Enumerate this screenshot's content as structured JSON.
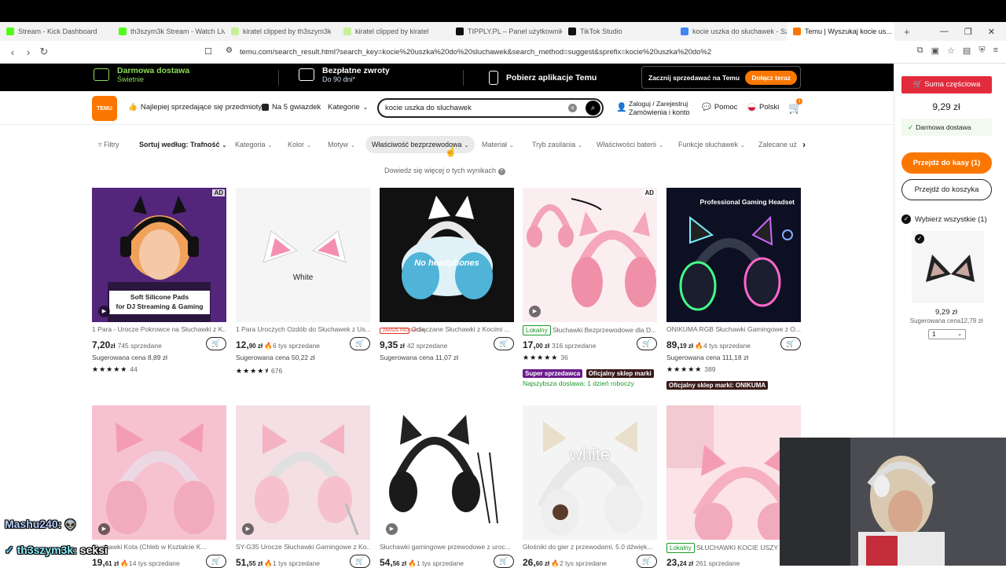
{
  "browser": {
    "tabs": [
      {
        "label": "Stream - Kick Dashboard",
        "color": "#53fc18"
      },
      {
        "label": "th3szym3k Stream - Watch Live",
        "color": "#53fc18"
      },
      {
        "label": "kiratel clipped by th3szym3k",
        "color": "#c8f09a"
      },
      {
        "label": "kiratel clipped by kiratel",
        "color": "#c8f09a"
      },
      {
        "label": "TIPPLY.PL – Panel użytkownika",
        "color": "#111111"
      },
      {
        "label": "TikTok Studio",
        "color": "#111111"
      },
      {
        "label": "kocie uszka do słuchawek - Szu",
        "color": "#4285f4"
      }
    ],
    "active_tab": {
      "label": "Temu | Wyszukaj kocie us...",
      "close": "×"
    },
    "new_tab": "+",
    "url": "temu.com/search_result.html?search_key=kocie%20uszka%20do%20sluchawek&search_method=suggest&sprefix=kocie%20uszka%20do%20sl..."
  },
  "promo": {
    "free_shipping": "Darmowa dostawa",
    "free_shipping_sub": "Świetnie",
    "free_returns": "Bezpłatne zwroty",
    "free_returns_sub": "Do 90 dni*",
    "app": "Pobierz aplikacje Temu",
    "sell": "Zacznij sprzedawać na Temu",
    "join": "Dołącz teraz"
  },
  "header": {
    "logo": "TEMU",
    "bestsellers": "Najlepiej sprzedające się przedmioty",
    "five_stars": "Na 5 gwiazdek",
    "categories": "Kategorie",
    "search_value": "kocie uszka do sluchawek",
    "login_line1": "Zaloguj / Zarejestruj",
    "login_line2": "Zamówienia i konto",
    "help": "Pomoc",
    "language": "Polski",
    "cart_count": "1"
  },
  "filters": [
    "Filtry",
    "Sortuj według: Trafność",
    "Kategoria",
    "Kolor",
    "Motyw",
    "Właściwość bezprzewodowa",
    "Materiał",
    "Tryb zasilania",
    "Właściwości baterii",
    "Funkcje słuchawek",
    "Zalecane uż"
  ],
  "learn_more": "Dowiedz się więcej o tych wynikach",
  "products_row1": [
    {
      "title": "1 Para - Urocze Pokrowce na Słuchawki z K...",
      "price_main": "7,20",
      "price_dec": "",
      "price_cur": "zł",
      "sold": "745 sprzedane",
      "suggested": "Sugerowana cena 8,89 zł",
      "stars": "★★★★★",
      "reviews": "44",
      "ad": "AD",
      "img_text": "Soft Silicone Pads\nfor DJ Streaming & Gaming"
    },
    {
      "title": "1 Para Uroczych Ozdób do Słuchawek z Us...",
      "price_main": "12,",
      "price_dec": "90",
      "price_cur": "zł",
      "sold": "6 tys sprzedane",
      "suggested": "Sugerowana cena 50,22 zł",
      "stars": "★★★★⯨",
      "reviews": "676",
      "img_text": "White"
    },
    {
      "title": "Odłączane Słuchawki z Kocimi ...",
      "badge": "ZAWSZE PRODUKCJA",
      "price_main": "9,35",
      "price_dec": "",
      "price_cur": "zł",
      "sold": "42 sprzedane",
      "suggested": "Sugerowana cena 11,07 zł",
      "img_text": "No headphones"
    },
    {
      "title": "Słuchawki Bezprzewodowe dla D...",
      "tag": "Lokalny",
      "price_main": "17,",
      "price_dec": "00",
      "price_cur": "zł",
      "sold": "316 sprzedane",
      "stars": "★★★★★",
      "reviews": "36",
      "ad": "AD",
      "seller_badge1": "Super sprzedawca",
      "seller_badge2": "Oficjalny sklep marki",
      "fast": "Najszybsza dostawa: 1 dzień roboczy"
    },
    {
      "title": "ONIKUMA RGB Słuchawki Gamingowe z O...",
      "price_main": "89,",
      "price_dec": "19",
      "price_cur": "zł",
      "sold": "4 tys sprzedane",
      "suggested": "Sugerowana cena 111,18 zł",
      "stars": "★★★★★",
      "reviews": "389",
      "seller_badge2": "Oficjalny sklep marki: ONIKUMA",
      "img_text": "Professional Gaming Headset"
    }
  ],
  "products_row2": [
    {
      "title": "Słuchawki Kota (Chleb w Kształcie K...",
      "price_main": "19,",
      "price_dec": "61",
      "price_cur": "zł",
      "sold": "14 tys sprzedane"
    },
    {
      "title": "SY-G35 Urocze Słuchawki Gamingowe z Ko...",
      "price_main": "51,",
      "price_dec": "55",
      "price_cur": "zł",
      "sold": "1 tys sprzedane"
    },
    {
      "title": "Słuchawki gamingowe przewodowe z uroc...",
      "price_main": "54,",
      "price_dec": "56",
      "price_cur": "zł",
      "sold": "1 tys sprzedane"
    },
    {
      "title": "Głośniki do gier z przewodami, 5.0 dźwięk...",
      "price_main": "26,",
      "price_dec": "60",
      "price_cur": "zł",
      "sold": "2 tys sprzedane",
      "img_text": "white"
    },
    {
      "title": "SŁUCHAWKI KOCIE USZY D...",
      "tag": "Lokalny",
      "price_main": "23,",
      "price_dec": "24",
      "price_cur": "zł",
      "sold": "261 sprzedane"
    }
  ],
  "cart_panel": {
    "subtotal_btn": "Suma częściowa",
    "total": "9,29 zł",
    "free_delivery": "Darmowa dostawa",
    "checkout": "Przejdź do kasy (1)",
    "to_cart": "Przejdź do koszyka",
    "select_all": "Wybierz wszystkie (1)",
    "item_price": "9,29 zł",
    "item_suggested": "Sugerowana cena12,79 zł",
    "qty": "1"
  },
  "overlay_chat": [
    {
      "name": "Mashu240:",
      "msg": ""
    },
    {
      "name": "th3szym3k:",
      "msg": "seksi"
    }
  ],
  "colors": {
    "brand": "#fb7701",
    "red": "#e22b3c",
    "green": "#8ddc5a"
  }
}
